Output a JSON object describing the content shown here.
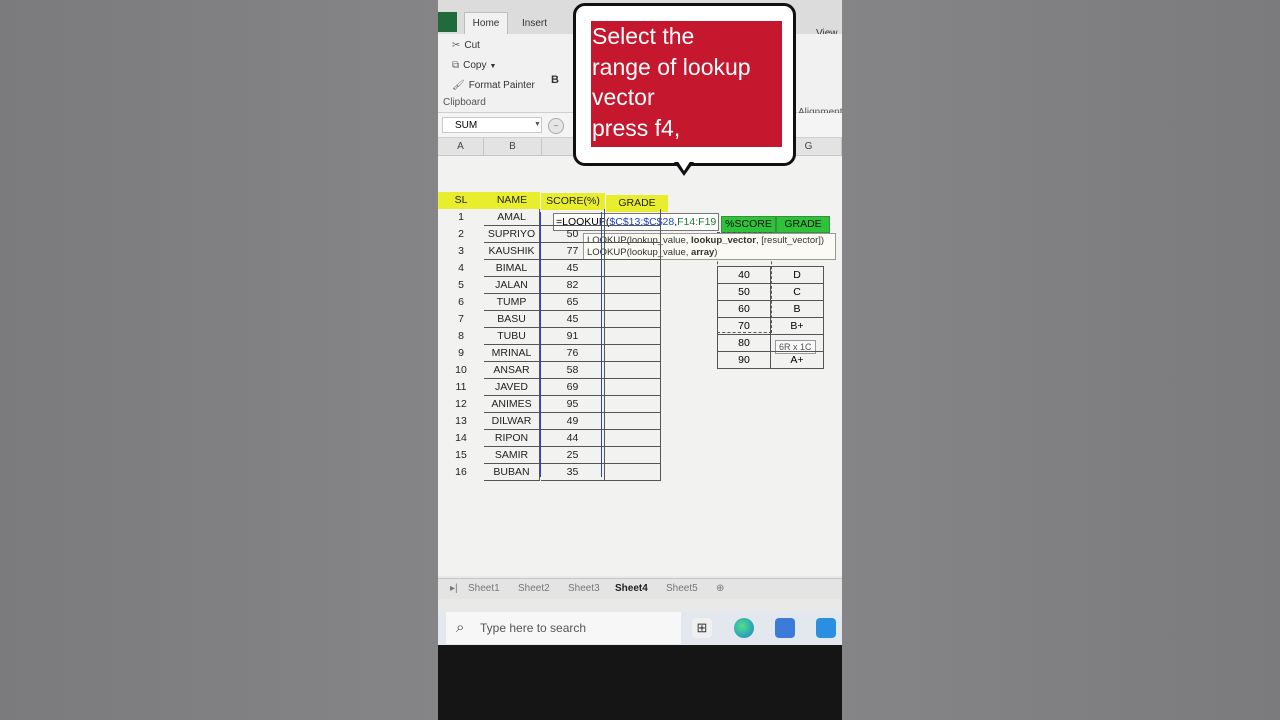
{
  "ribbon": {
    "tabs": [
      "Home",
      "Insert",
      "View"
    ],
    "clipboard": {
      "cut": "Cut",
      "copy": "Copy",
      "format_painter": "Format Painter",
      "group_label": "Clipboard"
    },
    "bold": "B",
    "alignment_label": "Alignment"
  },
  "formula_bar": {
    "name_box": "SUM"
  },
  "columns": [
    "A",
    "B",
    "G"
  ],
  "table": {
    "headers": [
      "SL",
      "NAME",
      "SCORE(%)",
      "GRADE"
    ],
    "rows": [
      {
        "sl": "1",
        "name": "AMAL",
        "score": ""
      },
      {
        "sl": "2",
        "name": "SUPRIYO",
        "score": "50"
      },
      {
        "sl": "3",
        "name": "KAUSHIK",
        "score": "77"
      },
      {
        "sl": "4",
        "name": "BIMAL",
        "score": "45"
      },
      {
        "sl": "5",
        "name": "JALAN",
        "score": "82"
      },
      {
        "sl": "6",
        "name": "TUMP",
        "score": "65"
      },
      {
        "sl": "7",
        "name": "BASU",
        "score": "45"
      },
      {
        "sl": "8",
        "name": "TUBU",
        "score": "91"
      },
      {
        "sl": "9",
        "name": "MRINAL",
        "score": "76"
      },
      {
        "sl": "10",
        "name": "ANSAR",
        "score": "58"
      },
      {
        "sl": "11",
        "name": "JAVED",
        "score": "69"
      },
      {
        "sl": "12",
        "name": "ANIMES",
        "score": "95"
      },
      {
        "sl": "13",
        "name": "DILWAR",
        "score": "49"
      },
      {
        "sl": "14",
        "name": "RIPON",
        "score": "44"
      },
      {
        "sl": "15",
        "name": "SAMIR",
        "score": "25"
      },
      {
        "sl": "16",
        "name": "BUBAN",
        "score": "35"
      }
    ]
  },
  "formula": {
    "prefix": "=LOOKUP(",
    "arg1": "$C$13:$C$28",
    "sep": ",",
    "arg2": "F14:F19"
  },
  "tooltip": {
    "line1_a": "LOOKUP(lookup_value, ",
    "line1_b": "lookup_vector",
    "line1_c": ", [result_vector])",
    "line2_a": "LOOKUP(lookup_value, ",
    "line2_b": "array",
    "line2_c": ")"
  },
  "lookup": {
    "headers": [
      "%SCORE",
      "GRADE"
    ],
    "rows": [
      {
        "score": "40",
        "grade": "D"
      },
      {
        "score": "50",
        "grade": "C"
      },
      {
        "score": "60",
        "grade": "B"
      },
      {
        "score": "70",
        "grade": "B+"
      },
      {
        "score": "80",
        "grade": ""
      },
      {
        "score": "90",
        "grade": "A+"
      }
    ]
  },
  "size_tip": "6R x 1C",
  "sheet_tabs": [
    "Sheet1",
    "Sheet2",
    "Sheet3",
    "Sheet4",
    "Sheet5"
  ],
  "taskbar": {
    "search_placeholder": "Type here to search"
  },
  "callout": {
    "text": "Select the\nrange of lookup\nvector\npress f4,"
  },
  "colors": {
    "header_yellow": "#e8ee2d",
    "header_green": "#2ec23a",
    "callout_red": "#c5182e"
  }
}
